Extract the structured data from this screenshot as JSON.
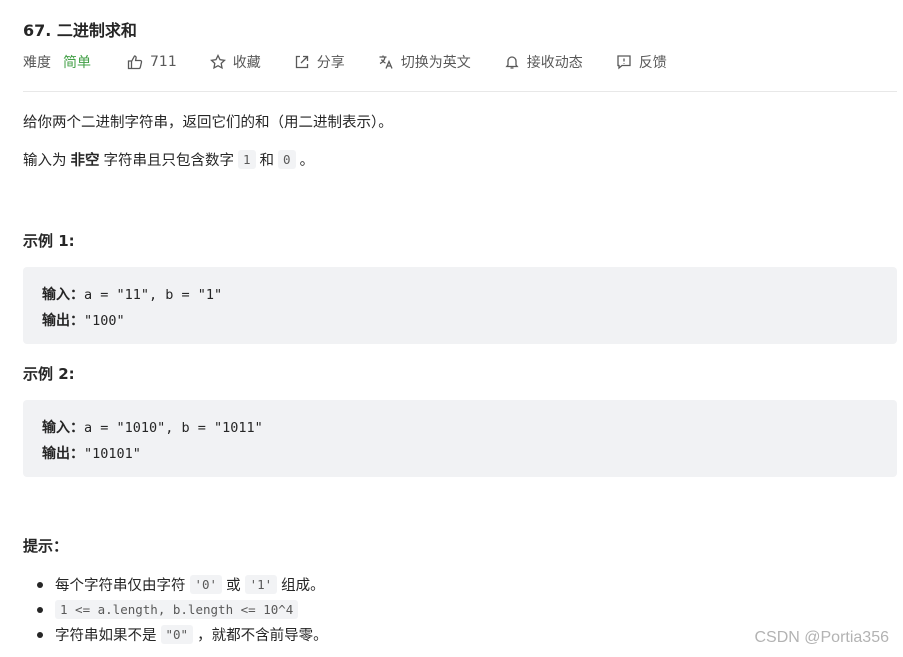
{
  "problem": {
    "title": "67. 二进制求和",
    "difficulty_label": "难度",
    "difficulty_value": "简单",
    "likes": "711",
    "actions": {
      "favorite": "收藏",
      "share": "分享",
      "switch_lang": "切换为英文",
      "follow": "接收动态",
      "feedback": "反馈"
    }
  },
  "description": {
    "line1": "给你两个二进制字符串，返回它们的和（用二进制表示）。",
    "line2_prefix": "输入为",
    "line2_bold": "非空",
    "line2_mid": "字符串且只包含数字",
    "line2_code1": "1",
    "line2_and": "和",
    "line2_code2": "0",
    "line2_end": "。"
  },
  "examples": [
    {
      "heading": "示例 1:",
      "input_label": "输入：",
      "input_value": "a = \"11\", b = \"1\"",
      "output_label": "输出：",
      "output_value": "\"100\""
    },
    {
      "heading": "示例 2:",
      "input_label": "输入：",
      "input_value": "a = \"1010\", b = \"1011\"",
      "output_label": "输出：",
      "output_value": "\"10101\""
    }
  ],
  "tips": {
    "heading": "提示：",
    "t1_prefix": "每个字符串仅由字符",
    "t1_code1": "'0'",
    "t1_or": "或",
    "t1_code2": "'1'",
    "t1_suffix": "组成。",
    "t2_code": "1 <= a.length, b.length <= 10^4",
    "t3_prefix": "字符串如果不是",
    "t3_code": "\"0\"",
    "t3_suffix": "，就都不含前导零。"
  },
  "watermark": "CSDN @Portia356"
}
